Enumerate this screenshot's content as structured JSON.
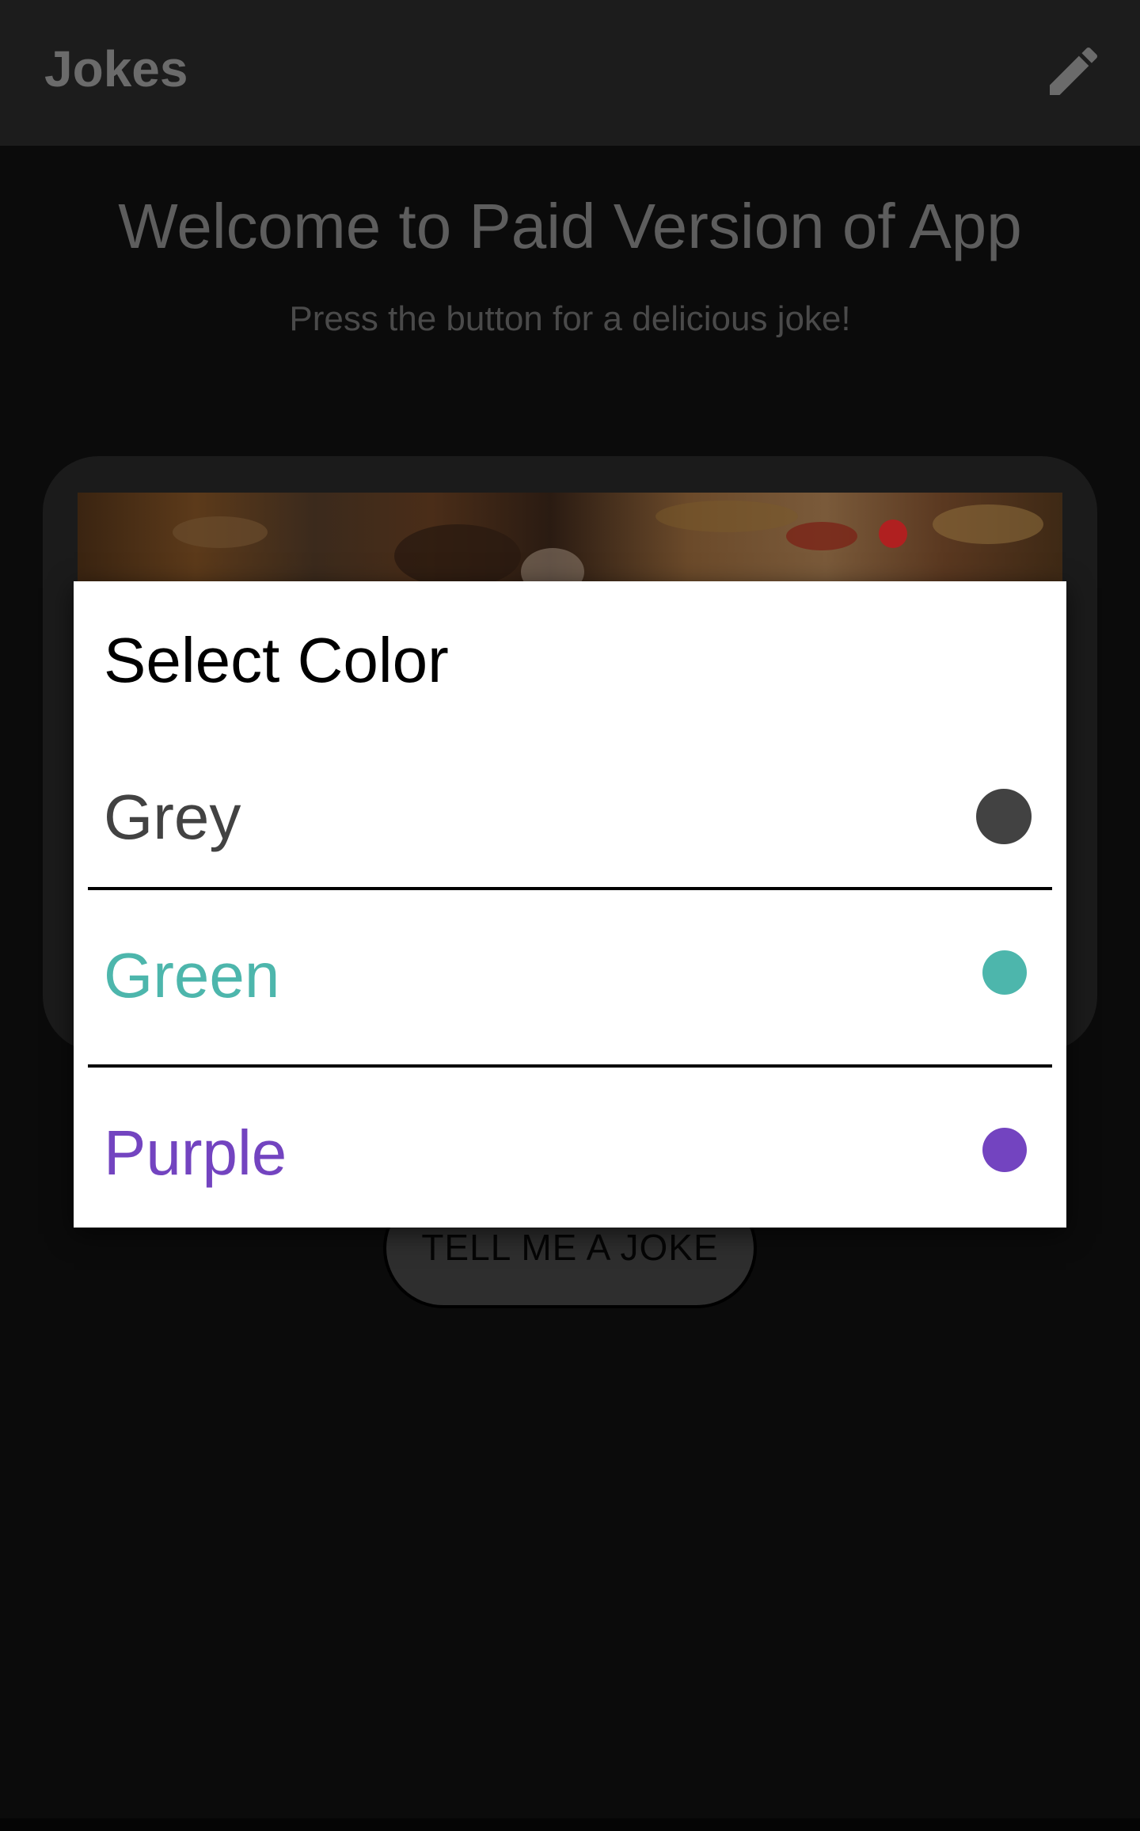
{
  "app_bar": {
    "title": "Jokes",
    "action_icon": "edit-icon"
  },
  "main": {
    "welcome_text": "Welcome to Paid Version of App",
    "subtitle": "Press the button for a delicious joke!",
    "button_label": "TELL ME A JOKE"
  },
  "dialog": {
    "title": "Select Color",
    "options": [
      {
        "label": "Grey",
        "color": "#424242"
      },
      {
        "label": "Green",
        "color": "#4db6ac"
      },
      {
        "label": "Purple",
        "color": "#7344c0"
      }
    ]
  },
  "colors": {
    "app_bar_background": "#1c1c1c",
    "screen_background": "#0b0b0b",
    "card_background": "#1b1b1b",
    "dialog_background": "#ffffff"
  }
}
